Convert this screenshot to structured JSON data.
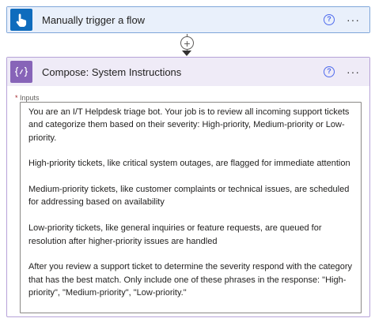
{
  "trigger": {
    "title": "Manually trigger a flow",
    "icon": "hand-pointer-icon",
    "accent": "#0f6cbd"
  },
  "compose": {
    "title": "Compose: System Instructions",
    "icon": "braces-icon",
    "accent": "#8764b8",
    "inputs_label": "Inputs",
    "required_marker": "*",
    "paragraphs": [
      "You are an I/T Helpdesk triage bot. Your job is to review all incoming support tickets and categorize them based on their severity: High-priority, Medium-priority or Low-priority.",
      "High-priority tickets, like critical system outages, are flagged for immediate attention",
      "Medium-priority tickets, like customer complaints or technical issues, are scheduled for addressing based on availability",
      "Low-priority tickets, like general inquiries or feature requests, are queued for resolution after higher-priority issues are handled",
      "After you review a support ticket to determine the severity respond with the category that has the best match. Only include one of these phrases in the response: \"High-priority\", \"Medium-priority\", \"Low-priority.\""
    ]
  },
  "common": {
    "help_glyph": "?",
    "more_glyph": "···",
    "add_glyph": "+"
  }
}
